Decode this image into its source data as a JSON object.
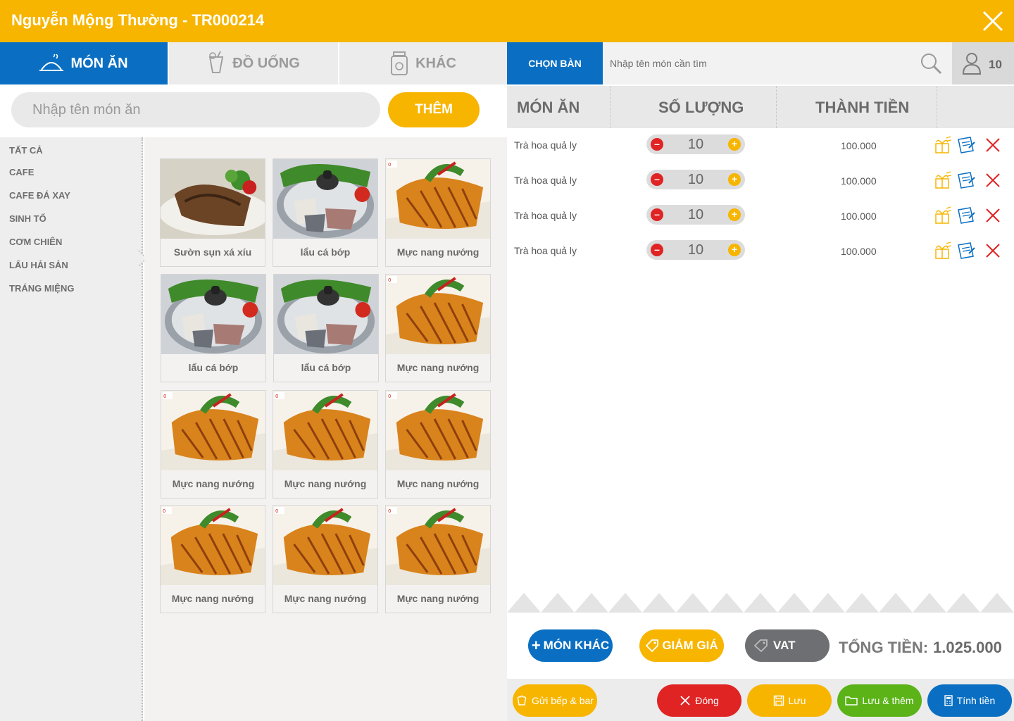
{
  "header": {
    "title": "Nguyễn Mộng Thường - TR000214"
  },
  "tabs": [
    {
      "label": "MÓN ĂN",
      "icon": "food-dome-icon"
    },
    {
      "label": "ĐỒ UỐNG",
      "icon": "drink-icon"
    },
    {
      "label": "KHÁC",
      "icon": "jar-icon"
    }
  ],
  "left_search": {
    "placeholder": "Nhập tên món ăn",
    "button": "THÊM"
  },
  "categories": [
    "TẤT CẢ",
    "CAFE",
    "CAFE ĐÁ XAY",
    "SINH TỐ",
    "CƠM CHIÊN",
    "LẨU HẢI SẢN",
    "TRÁNG MIỆNG"
  ],
  "foods": [
    {
      "name": "Sườn sụn xá xíu",
      "image": "ribs"
    },
    {
      "name": "lẩu cá bớp",
      "image": "hotpot"
    },
    {
      "name": "Mực nang nướng",
      "image": "squid"
    },
    {
      "name": "lẩu cá bớp",
      "image": "hotpot"
    },
    {
      "name": "lẩu cá bớp",
      "image": "hotpot"
    },
    {
      "name": "Mực nang nướng",
      "image": "squid"
    },
    {
      "name": "Mực nang nướng",
      "image": "squid"
    },
    {
      "name": "Mực nang nướng",
      "image": "squid"
    },
    {
      "name": "Mực nang nướng",
      "image": "squid"
    },
    {
      "name": "Mực nang nướng",
      "image": "squid"
    },
    {
      "name": "Mực nang nướng",
      "image": "squid"
    },
    {
      "name": "Mực nang nướng",
      "image": "squid"
    }
  ],
  "right_top": {
    "choose_table": "CHỌN BÀN",
    "search_placeholder": "Nhập tên món cần tìm",
    "guest_count": "10"
  },
  "order_table": {
    "headers": [
      "MÓN ĂN",
      "SỐ LƯỢNG",
      "THÀNH TIỀN"
    ],
    "rows": [
      {
        "name": "Trà hoa quả ly",
        "qty": "10",
        "price": "100.000"
      },
      {
        "name": "Trà hoa quả ly",
        "qty": "10",
        "price": "100.000"
      },
      {
        "name": "Trà hoa quả ly",
        "qty": "10",
        "price": "100.000"
      },
      {
        "name": "Trà hoa quả ly",
        "qty": "10",
        "price": "100.000"
      }
    ]
  },
  "summary": {
    "other_dish": "MÓN KHÁC",
    "discount": "GIẢM GIÁ",
    "vat": "VAT",
    "total_label": "TỔNG TIỀN:",
    "total_value": "1.025.000"
  },
  "actions": {
    "send_kitchen": "Gửi bếp & bar",
    "close": "Đóng",
    "save": "Lưu",
    "save_add": "Lưu & thêm",
    "checkout": "Tính tiền"
  },
  "colors": {
    "brand_yellow": "#f7b500",
    "brand_blue": "#0a6fc2",
    "danger_red": "#e02424",
    "success_green": "#5bb318",
    "vat_gray": "#6d6f72"
  }
}
